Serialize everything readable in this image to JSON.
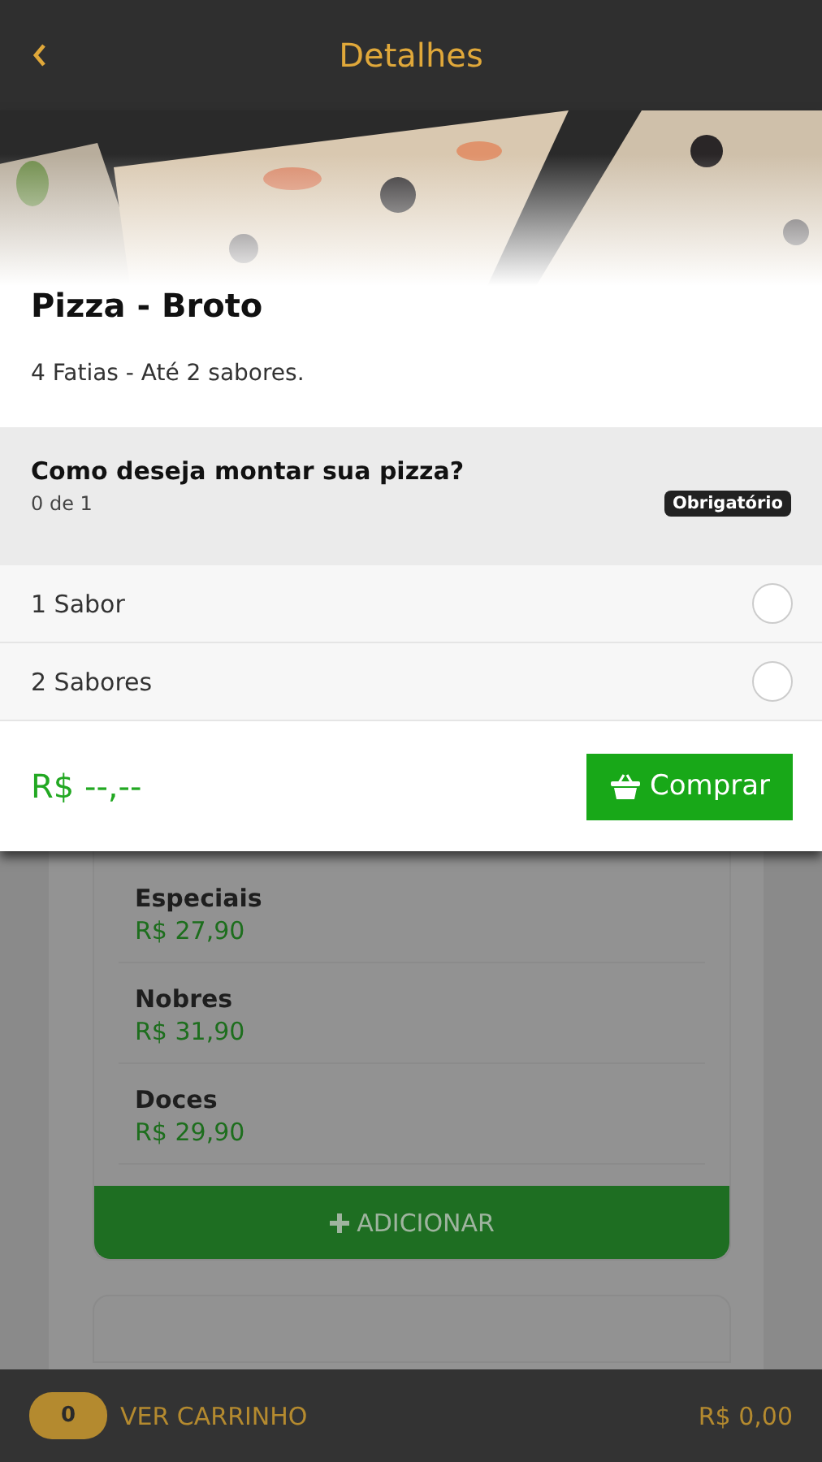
{
  "header": {
    "title": "Detalhes"
  },
  "product": {
    "name": "Pizza - Broto",
    "description": "4 Fatias - Até 2 sabores."
  },
  "question": {
    "title": "Como deseja montar sua pizza?",
    "count": "0 de 1",
    "badge": "Obrigatório"
  },
  "options": [
    {
      "label": "1 Sabor",
      "selected": false
    },
    {
      "label": "2 Sabores",
      "selected": false
    }
  ],
  "footer": {
    "price": "R$ --,--",
    "buy_button": "Comprar"
  },
  "menu": {
    "items": [
      {
        "name": "Especiais",
        "price": "R$ 27,90"
      },
      {
        "name": "Nobres",
        "price": "R$ 31,90"
      },
      {
        "name": "Doces",
        "price": "R$ 29,90"
      }
    ],
    "add_button": "ADICIONAR"
  },
  "cart_bar": {
    "count": "0",
    "label": "VER CARRINHO",
    "total": "R$ 0,00"
  }
}
